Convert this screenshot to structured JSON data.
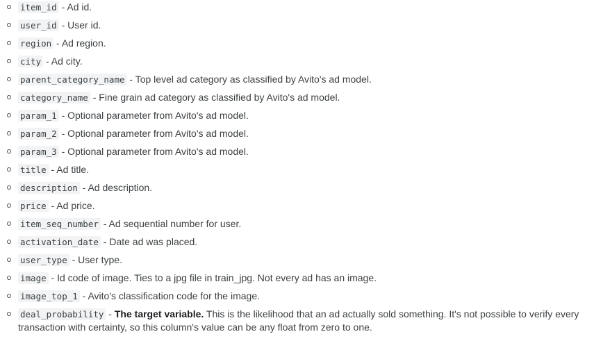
{
  "fields": [
    {
      "code": "item_id",
      "desc": " - Ad id."
    },
    {
      "code": "user_id",
      "desc": " - User id."
    },
    {
      "code": "region",
      "desc": " - Ad region."
    },
    {
      "code": "city",
      "desc": " - Ad city."
    },
    {
      "code": "parent_category_name",
      "desc": " - Top level ad category as classified by Avito's ad model."
    },
    {
      "code": "category_name",
      "desc": " - Fine grain ad category as classified by Avito's ad model."
    },
    {
      "code": "param_1",
      "desc": " - Optional parameter from Avito's ad model."
    },
    {
      "code": "param_2",
      "desc": " - Optional parameter from Avito's ad model."
    },
    {
      "code": "param_3",
      "desc": " - Optional parameter from Avito's ad model."
    },
    {
      "code": "title",
      "desc": " - Ad title."
    },
    {
      "code": "description",
      "desc": " - Ad description."
    },
    {
      "code": "price",
      "desc": " - Ad price."
    },
    {
      "code": "item_seq_number",
      "desc": " - Ad sequential number for user."
    },
    {
      "code": "activation_date",
      "desc": " - Date ad was placed."
    },
    {
      "code": "user_type",
      "desc": " - User type."
    },
    {
      "code": "image",
      "desc": " - Id code of image. Ties to a jpg file in train_jpg. Not every ad has an image."
    },
    {
      "code": "image_top_1",
      "desc": " - Avito's classification code for the image."
    }
  ],
  "last_field": {
    "code": "deal_probability",
    "dash": " - ",
    "strong": "The target variable.",
    "desc": " This is the likelihood that an ad actually sold something. It's not possible to verify every transaction with certainty, so this column's value can be any float from zero to one."
  }
}
